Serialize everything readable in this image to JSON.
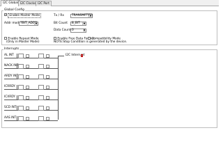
{
  "tabs": [
    "I2C Global",
    "I2C Clocks",
    "I2C Port"
  ],
  "global_config": {
    "title": "Global Config",
    "enable_master_mode": {
      "label": "Enable Master Mode",
      "checked": true
    },
    "addr_mode": {
      "label": "Addr mode",
      "value": "7BIT_ADDR",
      "options_visible": [
        "7BIT_ADDR"
      ]
    },
    "enable_repeat_mode": {
      "label": "Enable Repeat Mode",
      "checked": false,
      "note": "(Only in Master Mode)"
    },
    "tx_rx": {
      "label": "Tx / Rx",
      "value": "TRANSMITTER"
    },
    "bit_count": {
      "label": "Bit Count",
      "value": "8_BIT"
    },
    "data_count": {
      "label": "Data Count",
      "value": "0"
    },
    "enable_free_data_format": {
      "label": "Enable Free Data Format",
      "checked": false
    },
    "compatibility_mode": {
      "label": "Compatibility Mode",
      "checked": false
    },
    "note": "NOTE:Stop Condition is generated by the device."
  },
  "interrupts": {
    "title": "Interrupts",
    "rows": [
      {
        "label": "AL INT"
      },
      {
        "label": "NACK INT"
      },
      {
        "label": "ARDY INT"
      },
      {
        "label": "ICRRDY"
      },
      {
        "label": "ICXRDY"
      },
      {
        "label": "SCD INT"
      },
      {
        "label": "AAS INT"
      }
    ],
    "output_label": "I2C Interrupt",
    "colors": {
      "wire": "#555555",
      "marker": "#cc0000"
    }
  }
}
